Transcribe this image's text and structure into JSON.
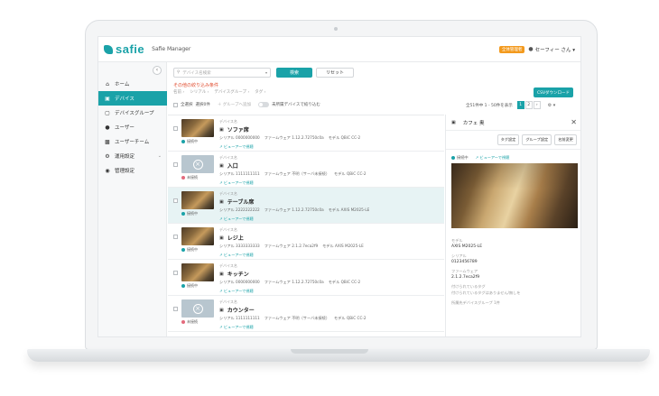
{
  "header": {
    "logo": "safie",
    "app_name": "Safie Manager",
    "role_badge": "全体管理者",
    "user": "セーフィー さん ▾"
  },
  "sidebar": {
    "collapse": "‹",
    "items": [
      {
        "label": "ホーム",
        "icon": "home-icon"
      },
      {
        "label": "デバイス",
        "icon": "camera-icon"
      },
      {
        "label": "デバイスグループ",
        "icon": "folder-icon"
      },
      {
        "label": "ユーザー",
        "icon": "user-icon"
      },
      {
        "label": "ユーザーチーム",
        "icon": "team-icon"
      },
      {
        "label": "運用設定",
        "icon": "settings-icon",
        "caret": "⌄"
      },
      {
        "label": "管理設定",
        "icon": "admin-icon"
      }
    ]
  },
  "search": {
    "placeholder": "デバイス名検索",
    "search_label": "検索",
    "reset_label": "リセット"
  },
  "filters": {
    "title": "その他の絞り込み条件",
    "items": [
      "名前 ›",
      "シリアル ›",
      "デバイスグループ ›",
      "タグ ›"
    ]
  },
  "csv_label": "CSVダウンロード",
  "toolbar": {
    "select_all": "全選択",
    "selected": "選択0件",
    "add_group": "＋ グループへ追加",
    "unset_filter": "未所属デバイスで絞り込む"
  },
  "pager": {
    "summary": "全51件中 1 - 50件を表示",
    "pages": [
      "1",
      "2",
      "›"
    ],
    "settings": "⚙ ▾"
  },
  "devices": [
    {
      "label": "デバイス名",
      "name": "ソファ席",
      "status": "接続中",
      "online": true,
      "serial": "シリアル 0000000000",
      "firmware": "ファームウェア 1.12.2.72750c0a",
      "model": "モデル QBiC CC-2",
      "viewer": "ビューアーで視聴",
      "selected": false
    },
    {
      "label": "デバイス名",
      "name": "入口",
      "status": "未接続",
      "online": false,
      "serial": "シリアル 1111111111",
      "firmware": "ファームウェア 不明（サーバ未接続）",
      "model": "モデル QBiC CC-2",
      "viewer": "ビューアーで視聴",
      "selected": false
    },
    {
      "label": "デバイス名",
      "name": "テーブル席",
      "status": "接続中",
      "online": true,
      "serial": "シリアル 2222222222",
      "firmware": "ファームウェア 1.12.2.72750c0a",
      "model": "モデル AXIS M2025-LE",
      "viewer": "ビューアーで視聴",
      "selected": true
    },
    {
      "label": "デバイス名",
      "name": "レジ上",
      "status": "接続中",
      "online": true,
      "serial": "シリアル 3333333333",
      "firmware": "ファームウェア 2.1.2.7eca2f9",
      "model": "モデル AXIS M2025-LE",
      "viewer": "ビューアーで視聴",
      "selected": false
    },
    {
      "label": "デバイス名",
      "name": "キッチン",
      "status": "接続中",
      "online": true,
      "serial": "シリアル 0000000000",
      "firmware": "ファームウェア 1.12.2.72750c0a",
      "model": "モデル QBiC CC-2",
      "viewer": "ビューアーで視聴",
      "selected": false
    },
    {
      "label": "デバイス名",
      "name": "カウンター",
      "status": "未接続",
      "online": false,
      "serial": "シリアル 1111111111",
      "firmware": "ファームウェア 不明（サーバ未接続）",
      "model": "モデル QBiC CC-2",
      "viewer": "ビューアーで視聴",
      "selected": false
    }
  ],
  "detail": {
    "title": "カフェ 奥",
    "close": "✕",
    "buttons": [
      "タグ設定",
      "グループ設定",
      "名前変更"
    ],
    "status": "接続中",
    "viewer": "ビューアーで視聴",
    "model_label": "モデル",
    "model_value": "AXIS M2025-LE",
    "serial_label": "シリアル",
    "serial_value": "0123456789",
    "firmware_label": "ファームウェア",
    "firmware_value": "2.1.2.7eca2f9",
    "tags_label": "付けられているタグ",
    "tags_value": "付けられているタグはありません/無しを",
    "groups_label": "所属先デバイスグループ 1件"
  },
  "colors": {
    "accent": "#1aa2a8",
    "alert": "#e0492b",
    "badge": "#f39a1e"
  }
}
